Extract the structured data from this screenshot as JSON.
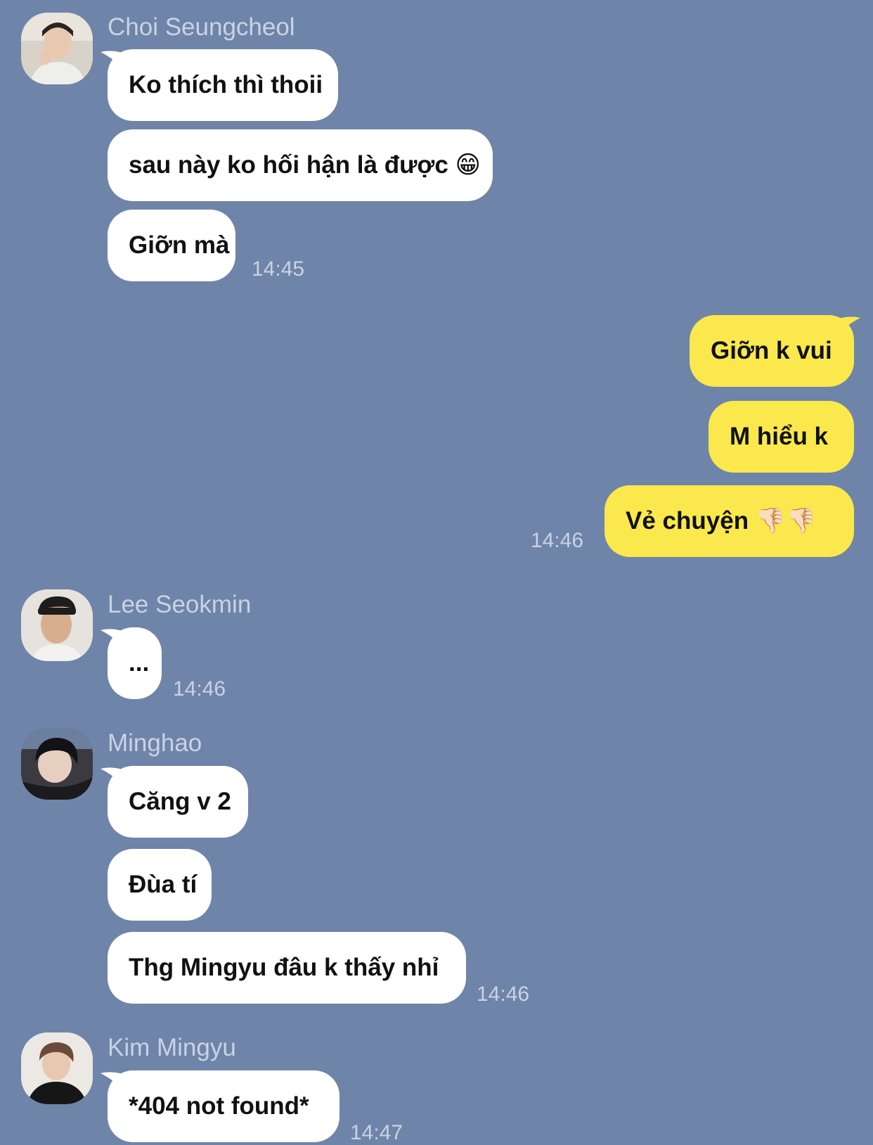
{
  "colors": {
    "background": "#6f84a9",
    "incoming_bubble": "#ffffff",
    "outgoing_bubble": "#fbe84d",
    "muted_text": "#c9d3e4"
  },
  "groups": [
    {
      "sender": "Choi Seungcheol",
      "messages": [
        "Ko thích thì thoii",
        "sau này ko hối hận là được 😁",
        "Giỡn mà"
      ],
      "time": "14:45"
    },
    {
      "sender": "",
      "outgoing": true,
      "messages": [
        "Giỡn k vui",
        "M hiểu k",
        "Vẻ chuyện 👎🏻👎🏻"
      ],
      "time": "14:46"
    },
    {
      "sender": "Lee Seokmin",
      "messages": [
        "..."
      ],
      "time": "14:46"
    },
    {
      "sender": "Minghao",
      "messages": [
        "Căng v 2",
        "Đùa tí",
        "Thg Mingyu đâu k thấy nhỉ"
      ],
      "time": "14:46"
    },
    {
      "sender": "Kim Mingyu",
      "messages": [
        "*404 not found*"
      ],
      "time": "14:47"
    }
  ]
}
